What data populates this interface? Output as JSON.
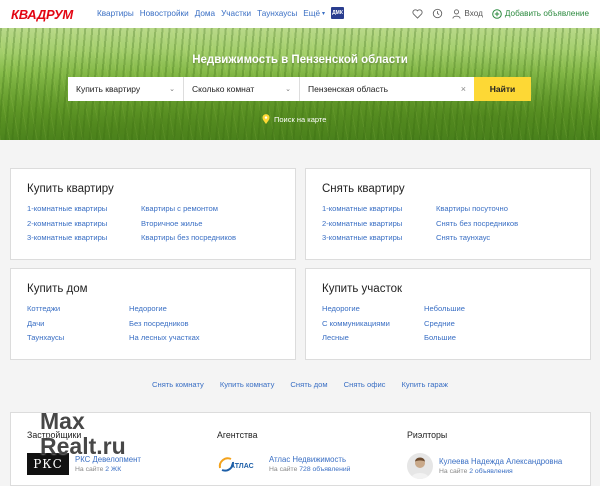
{
  "header": {
    "logo": "КВАДРУМ",
    "nav": [
      "Квартиры",
      "Новостройки",
      "Дома",
      "Участки",
      "Таунхаусы",
      "Ещё"
    ],
    "dmk_badge": "ДМК",
    "login": "Вход",
    "add_listing": "Добавить объявление"
  },
  "hero": {
    "title": "Недвижимость в Пензенской области",
    "deal_select": "Купить квартиру",
    "rooms_select": "Сколько комнат",
    "location_value": "Пензенская область",
    "clear": "×",
    "find_button": "Найти",
    "map_link": "Поиск на карте"
  },
  "cards": {
    "buy_flat": {
      "title": "Купить квартиру",
      "col1": [
        "1-комнатные квартиры",
        "2-комнатные квартиры",
        "3-комнатные квартиры"
      ],
      "col2": [
        "Квартиры с ремонтом",
        "Вторичное жилье",
        "Квартиры без посредников"
      ]
    },
    "rent_flat": {
      "title": "Снять квартиру",
      "col1": [
        "1-комнатные квартиры",
        "2-комнатные квартиры",
        "3-комнатные квартиры"
      ],
      "col2": [
        "Квартиры посуточно",
        "Снять без посредников",
        "Снять таунхаус"
      ]
    },
    "buy_house": {
      "title": "Купить дом",
      "col1": [
        "Коттеджи",
        "Дачи",
        "Таунхаусы"
      ],
      "col2": [
        "Недорогие",
        "Без посредников",
        "На лесных участках"
      ]
    },
    "buy_plot": {
      "title": "Купить участок",
      "col1": [
        "Недорогие",
        "С коммуникациями",
        "Лесные"
      ],
      "col2": [
        "Небольшие",
        "Средние",
        "Большие"
      ]
    }
  },
  "quick_links": [
    "Снять комнату",
    "Купить комнату",
    "Снять дом",
    "Снять офис",
    "Купить гараж"
  ],
  "bottom": {
    "developers_heading": "Застройщики",
    "developer_logo": "РКС",
    "developer_name": "РКС Девелопмент",
    "developer_sub_prefix": "На сайте",
    "developer_sub_count": "2 ЖК",
    "agencies_heading": "Агентства",
    "agency_logo": "АТЛАС",
    "agency_name": "Атлас Недвижимость",
    "agency_sub_prefix": "На сайте",
    "agency_sub_count": "728 объявлений",
    "realtors_heading": "Риэлторы",
    "realtor_name": "Кулеева Надежда Александровна",
    "realtor_sub_prefix": "На сайте",
    "realtor_sub_count": "2 объявления"
  },
  "watermark": {
    "line1": "Max",
    "line2": "Realt.ru"
  },
  "colors": {
    "brand": "#e30613",
    "link": "#3a6fc4",
    "find_button": "#fdd835",
    "add_green": "#2b8a3e"
  }
}
